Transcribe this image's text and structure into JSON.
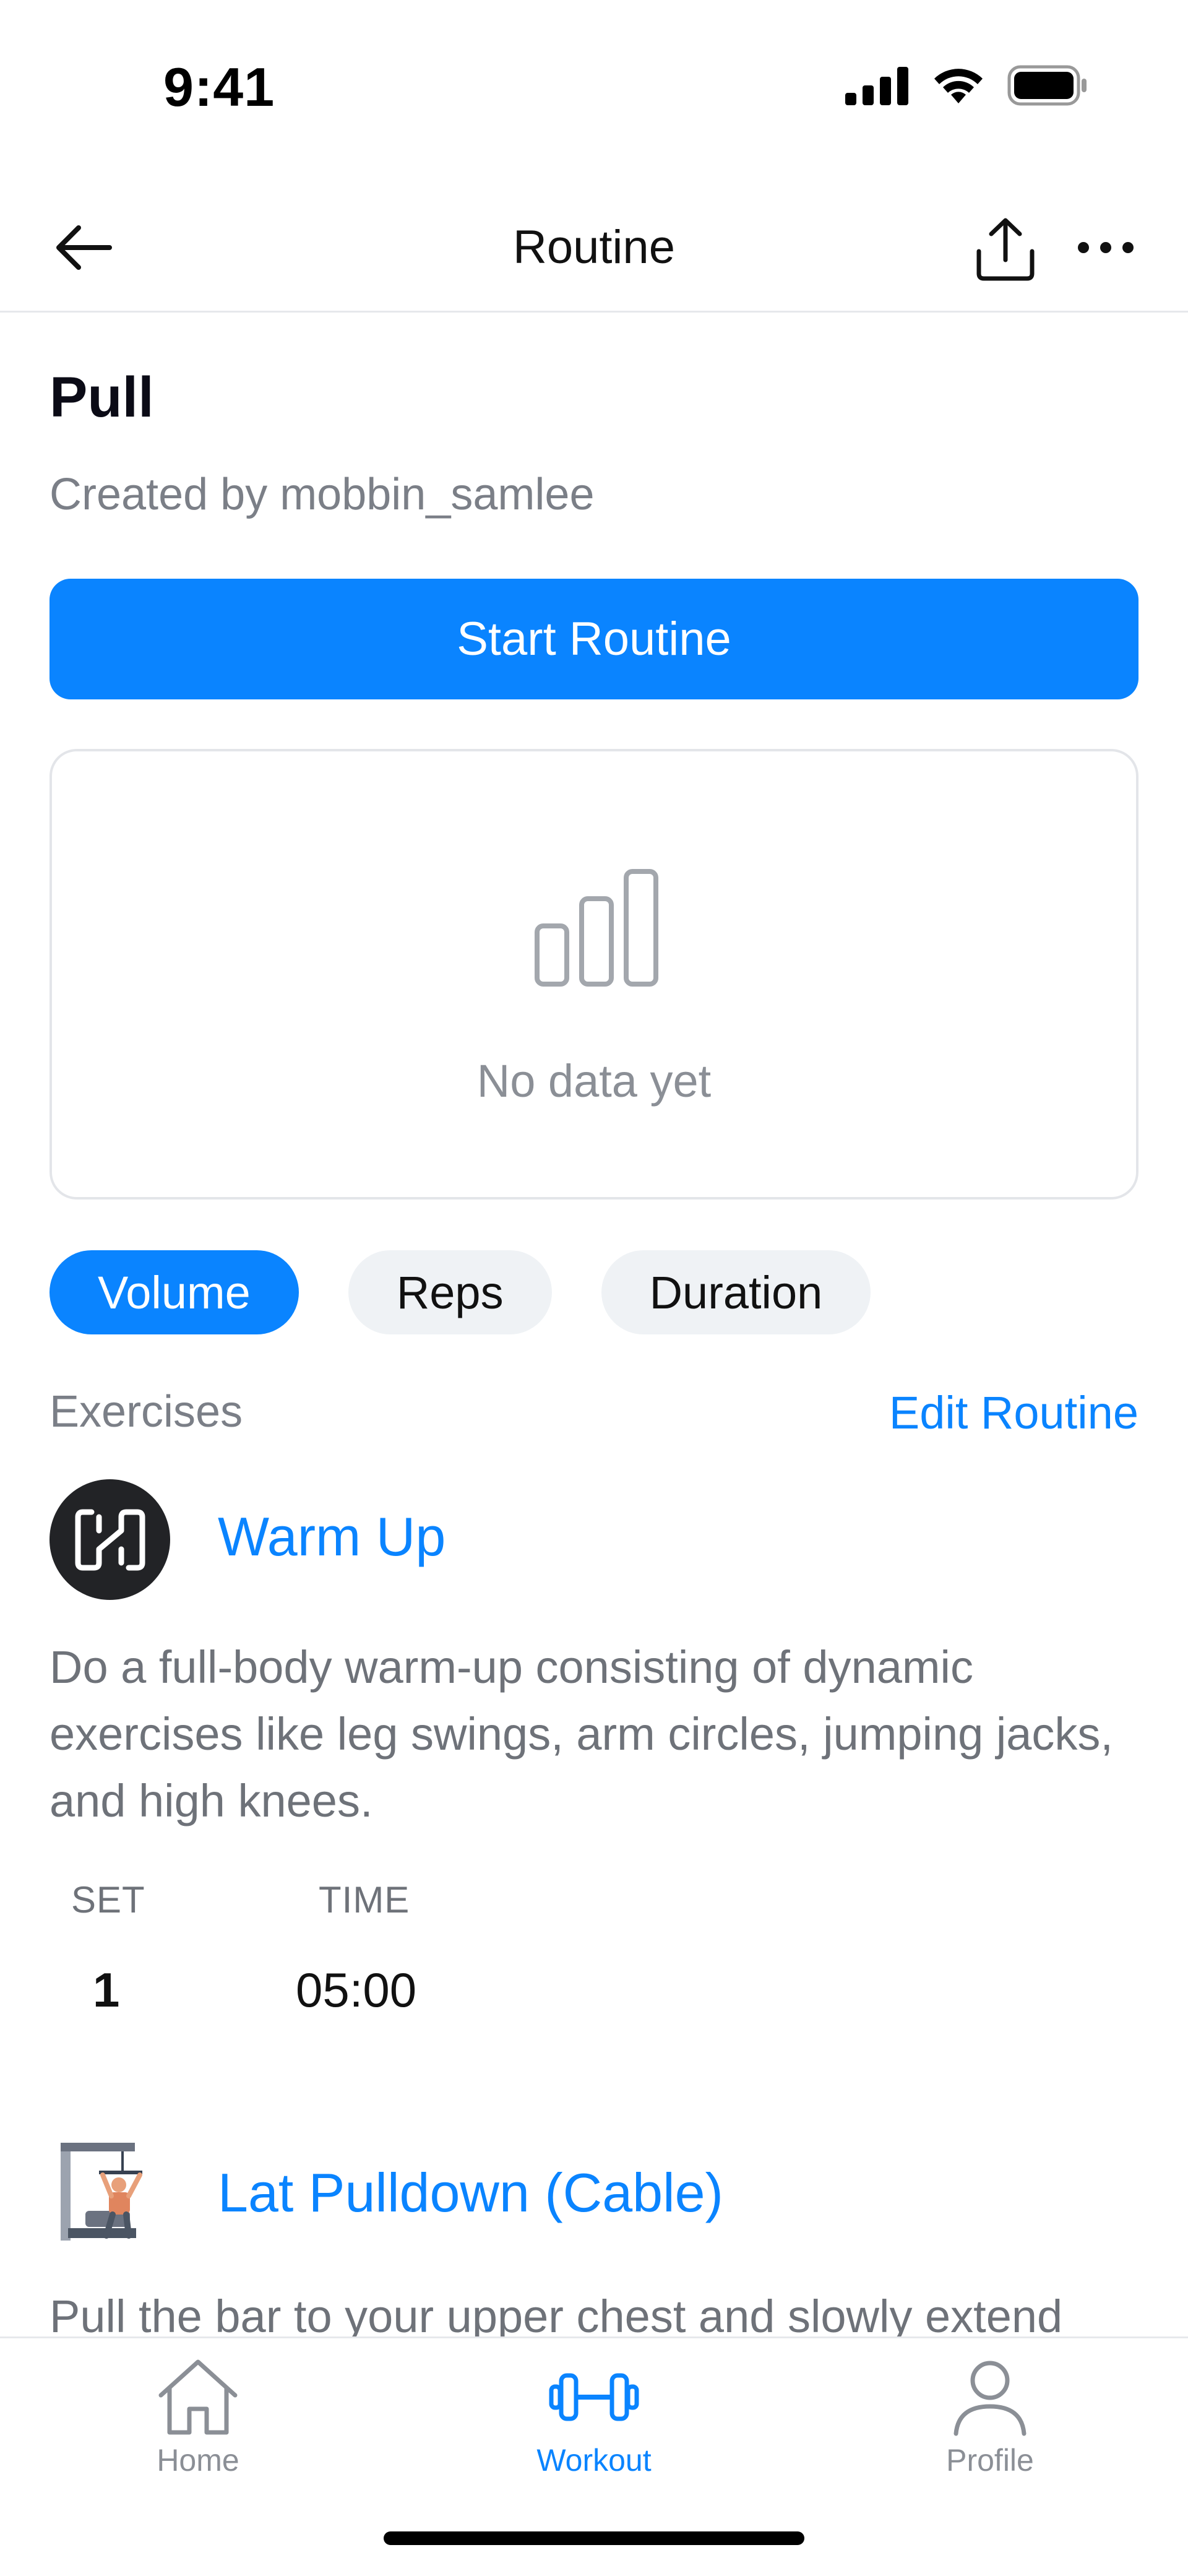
{
  "status_bar": {
    "time": "9:41"
  },
  "nav": {
    "title": "Routine"
  },
  "routine": {
    "title": "Pull",
    "creator": "Created by mobbin_samlee",
    "start_label": "Start Routine"
  },
  "chart_card": {
    "empty_text": "No data yet"
  },
  "metric_tabs": [
    {
      "label": "Volume",
      "active": true
    },
    {
      "label": "Reps",
      "active": false
    },
    {
      "label": "Duration",
      "active": false
    }
  ],
  "exercises_section": {
    "label": "Exercises",
    "edit_label": "Edit Routine"
  },
  "exercises": [
    {
      "name": "Warm Up",
      "description": "Do a full-body warm-up consisting of dynamic exercises like leg swings, arm circles, jumping jacks, and high knees.",
      "columns": {
        "set": "SET",
        "time": "TIME"
      },
      "sets": [
        {
          "set": "1",
          "time": "05:00"
        }
      ]
    },
    {
      "name": "Lat Pulldown (Cable)",
      "description": "Pull the bar to your upper chest and slowly extend"
    }
  ],
  "tab_bar": {
    "items": [
      {
        "label": "Home",
        "icon": "home-icon"
      },
      {
        "label": "Workout",
        "icon": "dumbbell-icon"
      },
      {
        "label": "Profile",
        "icon": "person-icon"
      }
    ],
    "active": "Workout"
  },
  "colors": {
    "accent": "#0a84ff",
    "muted_text": "#7b7f87",
    "pill_bg": "#eff2f5",
    "avatar_bg": "#222326"
  }
}
